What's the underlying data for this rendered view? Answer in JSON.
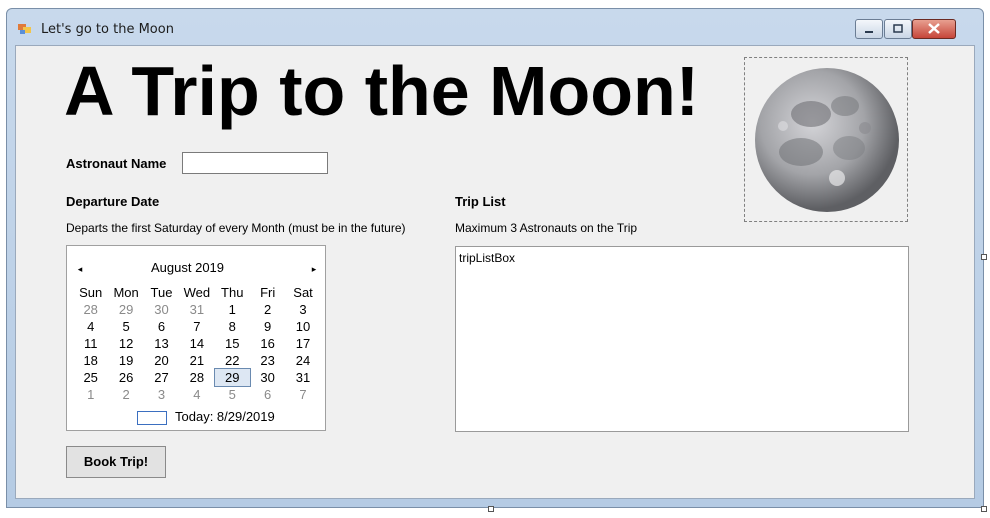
{
  "window": {
    "title": "Let's go to the Moon"
  },
  "form": {
    "heading": "A Trip to the Moon!",
    "astronaut_label": "Astronaut Name",
    "astronaut_value": "",
    "departure_label": "Departure Date",
    "departure_hint": "Departs the first Saturday of every Month (must be in the future)",
    "trip_list_label": "Trip List",
    "trip_list_hint": "Maximum 3 Astronauts on the Trip",
    "listbox_name": "tripListBox",
    "book_button": "Book Trip!"
  },
  "calendar": {
    "prev": "◂",
    "next": "▸",
    "month": "August 2019",
    "weekdays": [
      "Sun",
      "Mon",
      "Tue",
      "Wed",
      "Thu",
      "Fri",
      "Sat"
    ],
    "weeks": [
      [
        "28",
        "29",
        "30",
        "31",
        "1",
        "2",
        "3"
      ],
      [
        "4",
        "5",
        "6",
        "7",
        "8",
        "9",
        "10"
      ],
      [
        "11",
        "12",
        "13",
        "14",
        "15",
        "16",
        "17"
      ],
      [
        "18",
        "19",
        "20",
        "21",
        "22",
        "23",
        "24"
      ],
      [
        "25",
        "26",
        "27",
        "28",
        "29",
        "30",
        "31"
      ],
      [
        "1",
        "2",
        "3",
        "4",
        "5",
        "6",
        "7"
      ]
    ],
    "today": "Today: 8/29/2019",
    "selected": "29"
  },
  "icons": {
    "app": "app-form-icon",
    "minimize": "minimize-icon",
    "maximize": "maximize-icon",
    "close": "close-icon",
    "moon": "moon-image"
  }
}
